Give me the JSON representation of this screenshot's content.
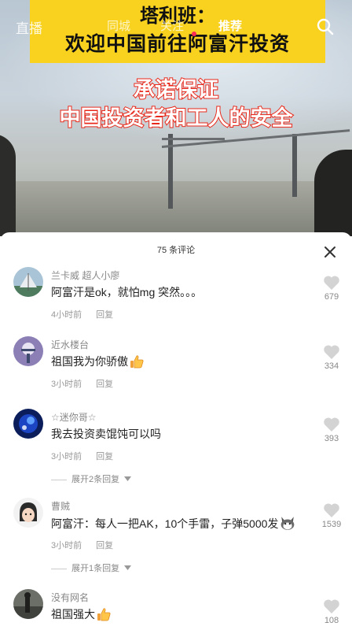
{
  "nav": {
    "live_label": "直播",
    "tabs": [
      {
        "label": "同城"
      },
      {
        "label": "关注"
      },
      {
        "label": "推荐"
      }
    ]
  },
  "video": {
    "headline_line1": "塔利班：",
    "headline_line2": "欢迎中国前往阿富汗投资",
    "caption_line1": "承诺保证",
    "caption_line2": "中国投资者和工人的安全"
  },
  "comments_panel": {
    "count_label": "75 条评论",
    "comments": [
      {
        "author": "兰卡威 超人小廖",
        "text": "阿富汗是ok，就怕mg 突然。。。",
        "time": "4小时前",
        "reply_label": "回复",
        "likes": "679"
      },
      {
        "author": "近水楼台",
        "text": "祖国我为你骄傲",
        "time": "3小时前",
        "reply_label": "回复",
        "likes": "334",
        "emoji": "thumbs-up"
      },
      {
        "author": "☆迷你哥☆",
        "text": "我去投资卖馄饨可以吗",
        "time": "3小时前",
        "reply_label": "回复",
        "likes": "393",
        "expand_label": "展开2条回复"
      },
      {
        "author": "曹贼",
        "text": "阿富汗：每人一把AK，10个手雷，子弹5000发",
        "time": "3小时前",
        "reply_label": "回复",
        "likes": "1539",
        "expand_label": "展开1条回复",
        "emoji": "cat-face"
      },
      {
        "author": "没有网名",
        "text": "祖国强大",
        "likes": "108",
        "emoji": "thumbs-up"
      }
    ]
  },
  "colors": {
    "headline_bg": "#f8d21e",
    "caption_stroke": "#e8281a",
    "accent": "#fe2c55"
  }
}
